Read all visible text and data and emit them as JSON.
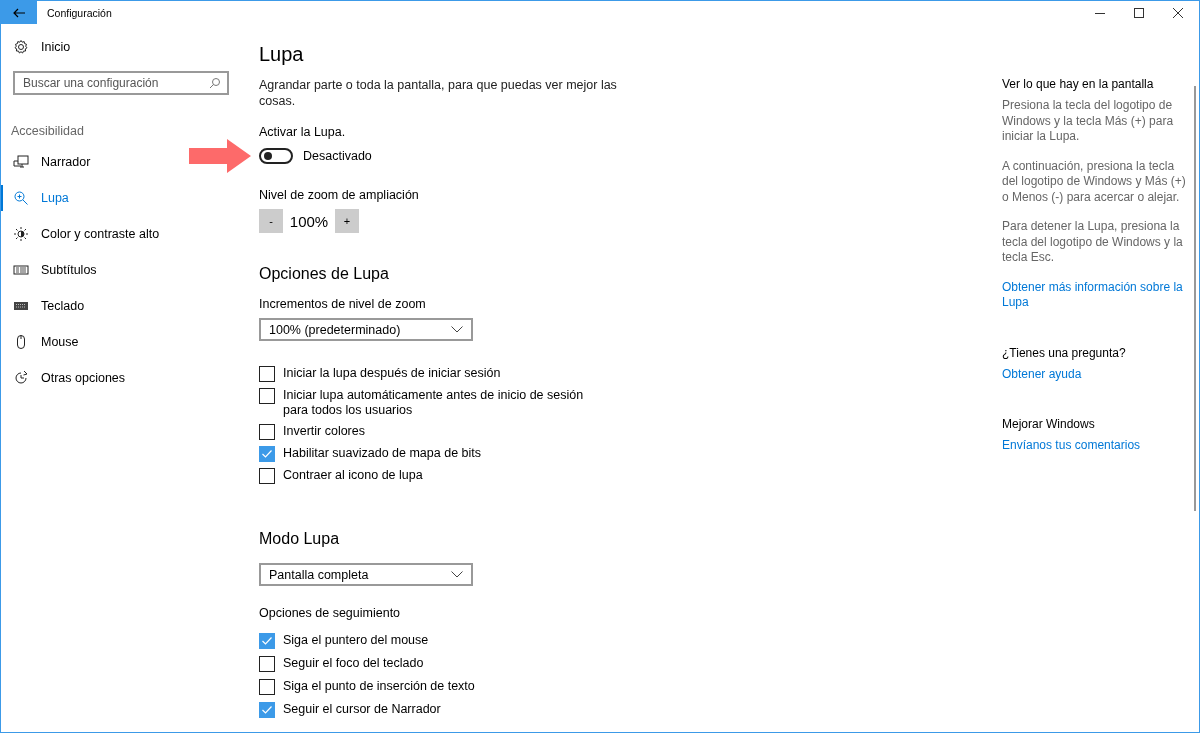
{
  "window": {
    "title": "Configuración"
  },
  "sidebar": {
    "home": {
      "label": "Inicio",
      "kind": "gear"
    },
    "search": {
      "placeholder": "Buscar una configuración"
    },
    "section": "Accesibilidad",
    "items": [
      {
        "label": "Narrador",
        "kind": "narrator",
        "selected": false
      },
      {
        "label": "Lupa",
        "kind": "magnifier",
        "selected": true
      },
      {
        "label": "Color y contraste alto",
        "kind": "brightness",
        "selected": false
      },
      {
        "label": "Subtítulos",
        "kind": "captions",
        "selected": false
      },
      {
        "label": "Teclado",
        "kind": "keyboard",
        "selected": false
      },
      {
        "label": "Mouse",
        "kind": "mouse",
        "selected": false
      },
      {
        "label": "Otras opciones",
        "kind": "other",
        "selected": false
      }
    ]
  },
  "page": {
    "title": "Lupa",
    "description": "Agrandar parte o toda la pantalla, para que puedas ver mejor las cosas.",
    "toggle": {
      "label": "Activar la Lupa.",
      "on": false,
      "state_text": "Desactivado"
    },
    "zoom": {
      "label": "Nivel de zoom de ampliación",
      "minus": "-",
      "value": "100%",
      "plus": "+"
    },
    "options_title": "Opciones de Lupa",
    "increments": {
      "label": "Incrementos de nivel de zoom",
      "value": "100% (predeterminado)"
    },
    "options": [
      {
        "label": "Iniciar la lupa después de iniciar sesión",
        "checked": false
      },
      {
        "label": "Iniciar lupa automáticamente antes de inicio de sesión para todos los usuarios",
        "checked": false
      },
      {
        "label": "Invertir colores",
        "checked": false
      },
      {
        "label": "Habilitar suavizado de mapa de bits",
        "checked": true
      },
      {
        "label": "Contraer al icono de lupa",
        "checked": false
      }
    ],
    "mode_title": "Modo Lupa",
    "mode": {
      "value": "Pantalla completa"
    },
    "tracking_title": "Opciones de seguimiento",
    "tracking": [
      {
        "label": "Siga el puntero del mouse",
        "checked": true
      },
      {
        "label": "Seguir el foco del teclado",
        "checked": false
      },
      {
        "label": "Siga el punto de inserción de texto",
        "checked": false
      },
      {
        "label": "Seguir el cursor de Narrador",
        "checked": true
      }
    ]
  },
  "aside": [
    {
      "heading": "Ver lo que hay en la pantalla",
      "paragraphs": [
        "Presiona la tecla del logotipo de Windows y la tecla Más (+) para iniciar la Lupa.",
        "A continuación, presiona la tecla del logotipo de Windows y Más (+) o Menos (-) para acercar o alejar.",
        "Para detener la Lupa, presiona la tecla del logotipo de Windows y la tecla Esc."
      ],
      "link": "Obtener más información sobre la Lupa"
    },
    {
      "heading": "¿Tienes una pregunta?",
      "link": "Obtener ayuda"
    },
    {
      "heading": "Mejorar Windows",
      "link": "Envíanos tus comentarios"
    }
  ]
}
